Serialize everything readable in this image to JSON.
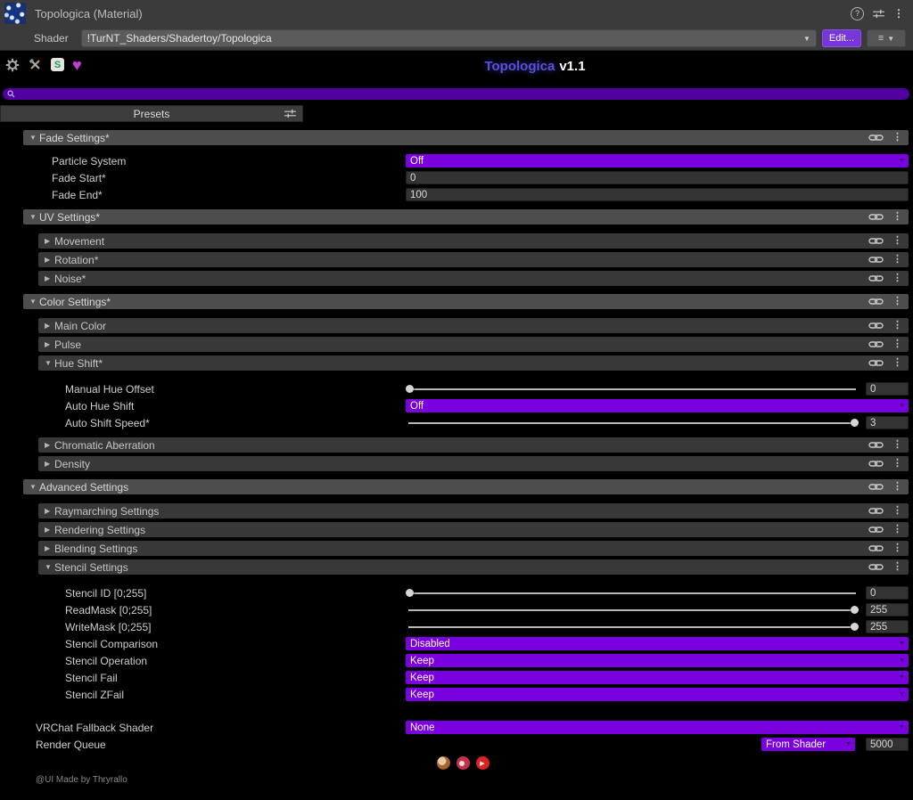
{
  "unity_header": {
    "window_title": "Topologica (Material)",
    "shader_label": "Shader",
    "shader_path": "!TurNT_Shaders/Shadertoy/Topologica",
    "edit_button_label": "Edit..."
  },
  "toolbar": {
    "title": "Topologica",
    "version": "v1.1"
  },
  "search": {
    "value": ""
  },
  "presets": {
    "label": "Presets"
  },
  "colors": {
    "accent_purple": "#7a00e0",
    "search_purple": "#4f009e",
    "title_purple": "#5a50dd",
    "edit_button_purple": "#7636d8"
  },
  "icons": {
    "expanded_arrow": "▼",
    "collapsed_arrow": "▶",
    "dropdown_arrow": "▼",
    "kebab": "⋮",
    "hamburger": "≡",
    "help": "?",
    "heart": "♥",
    "s_badge": "S",
    "play": "▶"
  },
  "fade_settings": {
    "label": "Fade Settings*",
    "particle_system": {
      "label": "Particle System",
      "value": "Off"
    },
    "fade_start": {
      "label": "Fade Start*",
      "value": "0"
    },
    "fade_end": {
      "label": "Fade End*",
      "value": "100"
    }
  },
  "uv_settings": {
    "label": "UV Settings*",
    "movement": {
      "label": "Movement"
    },
    "rotation": {
      "label": "Rotation*"
    },
    "noise": {
      "label": "Noise*"
    }
  },
  "color_settings": {
    "label": "Color Settings*",
    "main_color": {
      "label": "Main Color"
    },
    "pulse": {
      "label": "Pulse"
    },
    "hue_shift": {
      "label": "Hue Shift*",
      "manual_hue_offset": {
        "label": "Manual Hue Offset",
        "value": "0",
        "slider_percent": 0
      },
      "auto_hue_shift": {
        "label": "Auto Hue Shift",
        "value": "Off"
      },
      "auto_shift_speed": {
        "label": "Auto Shift Speed*",
        "value": "3",
        "slider_percent": 100
      }
    },
    "chromatic_aberration": {
      "label": "Chromatic Aberration"
    },
    "density": {
      "label": "Density"
    }
  },
  "advanced_settings": {
    "label": "Advanced Settings",
    "raymarching": {
      "label": "Raymarching Settings"
    },
    "rendering": {
      "label": "Rendering Settings"
    },
    "blending": {
      "label": "Blending Settings"
    },
    "stencil": {
      "label": "Stencil Settings",
      "stencil_id": {
        "label": "Stencil ID [0;255]",
        "value": "0",
        "slider_percent": 0
      },
      "readmask": {
        "label": "ReadMask [0;255]",
        "value": "255",
        "slider_percent": 100
      },
      "writemask": {
        "label": "WriteMask [0;255]",
        "value": "255",
        "slider_percent": 100
      },
      "stencil_comparison": {
        "label": "Stencil Comparison",
        "value": "Disabled"
      },
      "stencil_operation": {
        "label": "Stencil Operation",
        "value": "Keep"
      },
      "stencil_fail": {
        "label": "Stencil Fail",
        "value": "Keep"
      },
      "stencil_zfail": {
        "label": "Stencil ZFail",
        "value": "Keep"
      }
    }
  },
  "footer": {
    "vrchat_fallback": {
      "label": "VRChat Fallback Shader",
      "value": "None"
    },
    "render_queue": {
      "label": "Render Queue",
      "source": "From Shader",
      "value": "5000"
    },
    "credit": "@UI Made by Thryrallo"
  }
}
